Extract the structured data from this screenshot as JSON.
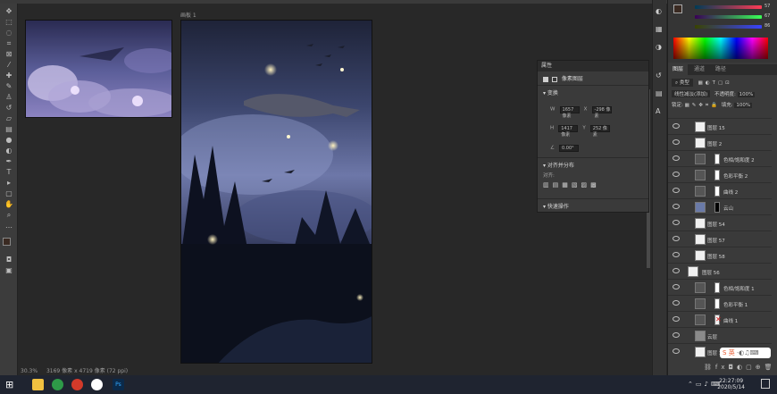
{
  "canvas_tab": {
    "title": "画板 1"
  },
  "status": {
    "zoom": "30.3%",
    "doc_info": "3169 像素 x 4719 像素 (72 ppi)"
  },
  "properties": {
    "title": "属性",
    "subtitle": "像素图层",
    "transform_label": "变换",
    "w_label": "W",
    "w_value": "1657 像素",
    "x_label": "X",
    "x_value": "-298 像素",
    "h_label": "H",
    "h_value": "1417 像素",
    "y_label": "Y",
    "y_value": "252 像素",
    "angle_value": "0.00°",
    "align_label": "对齐并分布",
    "align_to_label": "对齐:",
    "quick_label": "快速操作"
  },
  "layers_panel": {
    "tabs": [
      "图层",
      "通道",
      "路径"
    ],
    "filter_label": "类型",
    "blend_mode": "线性减淡(添加)",
    "opacity_label": "不透明度:",
    "opacity_value": "100%",
    "lock_label": "锁定:",
    "fill_label": "填充:",
    "fill_value": "100%",
    "layers": [
      {
        "name": "图层 15"
      },
      {
        "name": "图层 2"
      },
      {
        "name": "色相/饱和度 2"
      },
      {
        "name": "色彩平衡 2"
      },
      {
        "name": "曲线 2"
      },
      {
        "name": "云山"
      },
      {
        "name": "图层 54"
      },
      {
        "name": "图层 57"
      },
      {
        "name": "图层 58"
      },
      {
        "name": "图层 56"
      },
      {
        "name": "色相/饱和度 1"
      },
      {
        "name": "色彩平衡 1"
      },
      {
        "name": "曲线 1"
      },
      {
        "name": "云层"
      },
      {
        "name": "图层 1"
      }
    ]
  },
  "color": {
    "fg": "#3a2a22",
    "bg": "#f2efe8",
    "r": "57",
    "g": "67",
    "b": "86"
  },
  "taskbar": {
    "time": "22:27:09",
    "date": "2020/5/14"
  },
  "ime": {
    "label": "英"
  }
}
